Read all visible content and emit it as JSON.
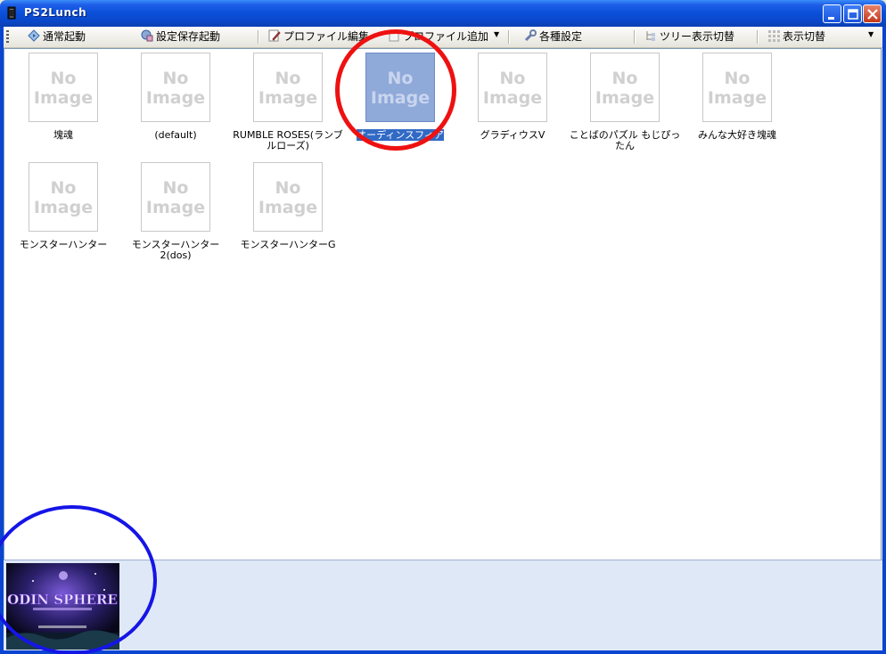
{
  "window": {
    "title": "PS2Lunch",
    "accent_color": "#0a4fd9",
    "close_color": "#c3391b"
  },
  "toolbar": {
    "items": [
      {
        "label": "通常起動",
        "icon": "play-diamond-icon"
      },
      {
        "label": "設定保存起動",
        "icon": "save-launch-icon"
      },
      {
        "label": "プロファイル編集",
        "icon": "edit-pencil-icon"
      },
      {
        "label": "プロファイル追加",
        "icon": "add-profile-icon"
      },
      {
        "label": "各種設定",
        "icon": "wrench-icon"
      },
      {
        "label": "ツリー表示切替",
        "icon": "tree-view-icon"
      },
      {
        "label": "表示切替",
        "icon": "grid-view-icon"
      }
    ]
  },
  "placeholder": {
    "line1": "No",
    "line2": "Image"
  },
  "profiles": [
    {
      "label": "塊魂",
      "selected": false
    },
    {
      "label": "(default)",
      "selected": false
    },
    {
      "label": "RUMBLE ROSES(ランブルローズ)",
      "selected": false
    },
    {
      "label": "オーディンスフィア",
      "selected": true
    },
    {
      "label": "グラディウスV",
      "selected": false
    },
    {
      "label": "ことばのパズル もじぴったん",
      "selected": false
    },
    {
      "label": "みんな大好き塊魂",
      "selected": false
    },
    {
      "label": "モンスターハンター",
      "selected": false
    },
    {
      "label": "モンスターハンター2(dos)",
      "selected": false
    },
    {
      "label": "モンスターハンターG",
      "selected": false
    }
  ],
  "preview": {
    "boxart_logo": "ODIN SPHERE",
    "selection_color": "#316ac5",
    "annotation_colors": [
      "#ee1111",
      "#1515e6"
    ]
  }
}
